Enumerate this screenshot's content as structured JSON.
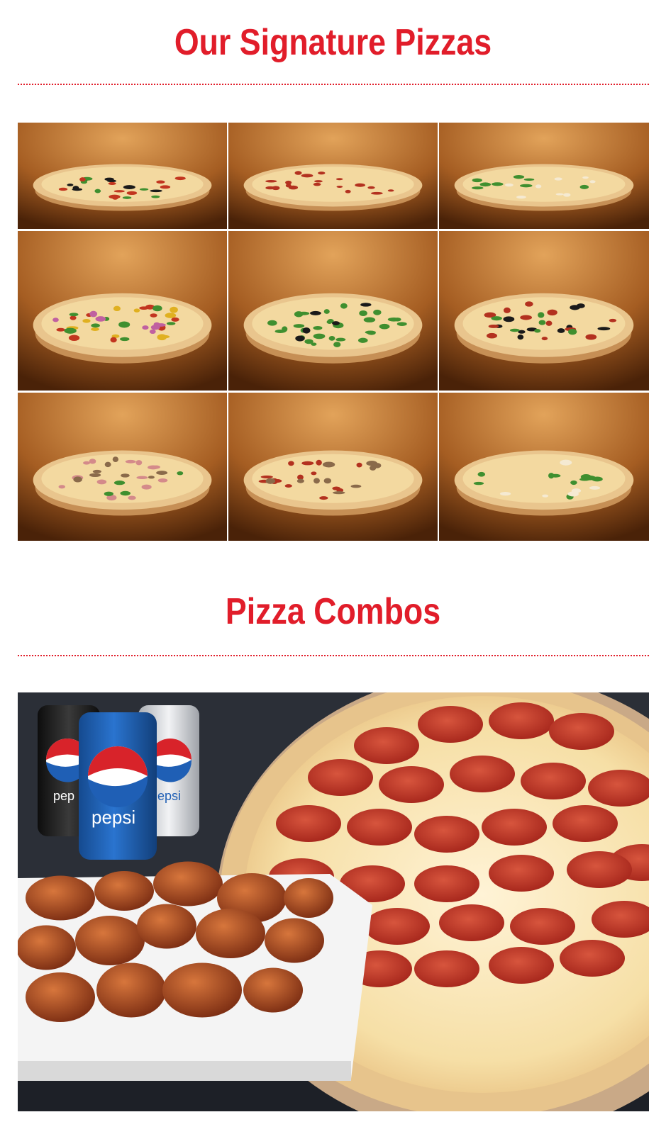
{
  "sections": {
    "signature": {
      "title": "Our Signature Pizzas",
      "pizzas": [
        {
          "toppings": "olives-basil"
        },
        {
          "toppings": "pepperoni"
        },
        {
          "toppings": "margherita-basil"
        },
        {
          "toppings": "vegetable"
        },
        {
          "toppings": "arugula"
        },
        {
          "toppings": "salami-olives"
        },
        {
          "toppings": "ham-mushroom"
        },
        {
          "toppings": "salami-mushroom"
        },
        {
          "toppings": "basil-cheese"
        }
      ]
    },
    "combos": {
      "title": "Pizza Combos",
      "can_labels": [
        "pepsi",
        "pepsi",
        "pepsi"
      ]
    }
  },
  "colors": {
    "accent": "#e11d2a",
    "pepsi_blue": "#1f5fb5",
    "background": "#ffffff"
  }
}
